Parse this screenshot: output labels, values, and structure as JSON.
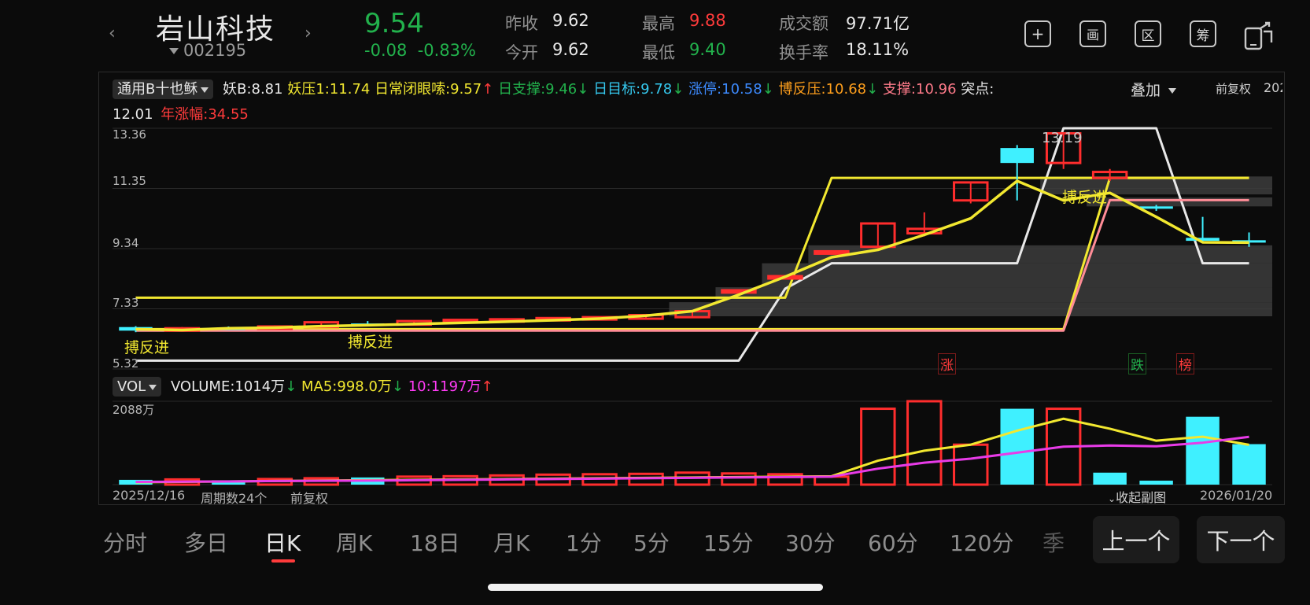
{
  "header": {
    "name": "岩山科技",
    "code": "002195",
    "price": "9.54",
    "change": "-0.08",
    "change_pct": "-0.83%",
    "prev_close_label": "昨收",
    "prev_close": "9.62",
    "open_label": "今开",
    "open": "9.62",
    "high_label": "最高",
    "high": "9.88",
    "low_label": "最低",
    "low": "9.40",
    "amount_label": "成交额",
    "amount": "97.71亿",
    "turnover_label": "换手率",
    "turnover": "18.11%",
    "icons": [
      "plus-icon",
      "picture-icon",
      "range-icon",
      "chip-icon",
      "phone-share-icon"
    ],
    "icon_glyphs": [
      "+",
      "画",
      "区",
      "筹",
      ""
    ]
  },
  "indicator": {
    "selector": "通用B十也稣",
    "items": [
      {
        "text": "妖B:8.81",
        "color": "#e8e8e8"
      },
      {
        "text": "妖压1:11.74",
        "color": "#f2e830"
      },
      {
        "text": "日常闭眼嗦:9.57",
        "color": "#f2e830",
        "arrow": "↑",
        "arrow_color": "#ff3b3b"
      },
      {
        "text": "日支撑:9.46",
        "color": "#22b14c",
        "arrow": "↓",
        "arrow_color": "#22b14c"
      },
      {
        "text": "日目标:9.78",
        "color": "#35c8ee",
        "arrow": "↓",
        "arrow_color": "#22b14c"
      },
      {
        "text": "涨停:10.58",
        "color": "#3d8bff",
        "arrow": "↓",
        "arrow_color": "#22b14c"
      },
      {
        "text": "博反压:10.68",
        "color": "#ff9f1c",
        "arrow": "↓",
        "arrow_color": "#22b14c"
      },
      {
        "text": "支撑:10.96",
        "color": "#ff7b8a"
      },
      {
        "text": "突点:",
        "color": "#e8e8e8"
      }
    ],
    "line2_value": "12.01",
    "line2_label": "年涨幅:34.55",
    "overlay": "叠加",
    "adjust": "前复权",
    "cut_text": "202"
  },
  "price_axis": [
    "13.36",
    "11.35",
    "9.34",
    "7.33",
    "5.32"
  ],
  "chart_labels": {
    "peak": "13.19",
    "bofanjin1": "搏反进",
    "bofanjin2": "搏反进",
    "bofanjin3": "搏反进",
    "tag_zhang": "涨",
    "tag_die": "跌",
    "tag_bang": "榜"
  },
  "volume": {
    "selector": "VOL",
    "volume_text": "VOLUME:1014万",
    "ma5_text": "MA5:998.0万",
    "ma10_text": "10:1197万",
    "axis_max": "2088万"
  },
  "chart_data": {
    "type": "candlestick",
    "candles": [
      {
        "o": 6.72,
        "c": 6.6,
        "h": 6.75,
        "l": 6.55
      },
      {
        "o": 6.62,
        "c": 6.68,
        "h": 6.72,
        "l": 6.6
      },
      {
        "o": 6.7,
        "c": 6.66,
        "h": 6.74,
        "l": 6.62
      },
      {
        "o": 6.68,
        "c": 6.74,
        "h": 6.78,
        "l": 6.65
      },
      {
        "o": 6.72,
        "c": 6.88,
        "h": 6.9,
        "l": 6.7
      },
      {
        "o": 6.84,
        "c": 6.8,
        "h": 6.92,
        "l": 6.76
      },
      {
        "o": 6.8,
        "c": 6.92,
        "h": 6.95,
        "l": 6.78
      },
      {
        "o": 6.88,
        "c": 6.96,
        "h": 6.98,
        "l": 6.84
      },
      {
        "o": 6.92,
        "c": 6.98,
        "h": 7.0,
        "l": 6.9
      },
      {
        "o": 6.95,
        "c": 7.02,
        "h": 7.05,
        "l": 6.92
      },
      {
        "o": 7.0,
        "c": 7.05,
        "h": 7.08,
        "l": 6.96
      },
      {
        "o": 7.0,
        "c": 7.12,
        "h": 7.16,
        "l": 6.98
      },
      {
        "o": 7.05,
        "c": 7.25,
        "h": 7.28,
        "l": 7.02
      },
      {
        "o": 7.95,
        "c": 7.95,
        "h": 7.98,
        "l": 7.92
      },
      {
        "o": 8.42,
        "c": 8.42,
        "h": 8.45,
        "l": 8.38
      },
      {
        "o": 9.25,
        "c": 9.25,
        "h": 9.28,
        "l": 9.22
      },
      {
        "o": 9.4,
        "c": 10.18,
        "h": 10.2,
        "l": 9.35
      },
      {
        "o": 9.85,
        "c": 10.0,
        "h": 10.55,
        "l": 9.75
      },
      {
        "o": 10.95,
        "c": 11.55,
        "h": 11.55,
        "l": 10.85
      },
      {
        "o": 12.7,
        "c": 12.2,
        "h": 12.8,
        "l": 10.95
      },
      {
        "o": 12.2,
        "c": 13.19,
        "h": 13.19,
        "l": 12.0
      },
      {
        "o": 11.7,
        "c": 11.9,
        "h": 12.0,
        "l": 11.6
      },
      {
        "o": 10.75,
        "c": 10.7,
        "h": 10.8,
        "l": 10.6
      },
      {
        "o": 9.7,
        "c": 9.6,
        "h": 10.4,
        "l": 9.55
      },
      {
        "o": 9.62,
        "c": 9.54,
        "h": 9.88,
        "l": 9.4
      }
    ],
    "yellow_line": [
      6.65,
      6.62,
      6.68,
      6.7,
      6.75,
      6.78,
      6.82,
      6.86,
      6.9,
      6.95,
      7.0,
      7.1,
      7.25,
      7.8,
      8.4,
      9.05,
      9.3,
      9.8,
      10.35,
      11.6,
      10.95,
      11.2,
      10.4,
      9.55,
      9.54
    ],
    "white_channel_upper": [
      5.6,
      5.6,
      5.6,
      5.6,
      5.6,
      5.6,
      5.6,
      5.6,
      5.6,
      5.6,
      5.6,
      5.6,
      5.6,
      5.6,
      8.4,
      8.4,
      8.4,
      8.4,
      8.4,
      13.36,
      13.36,
      13.36,
      8.4,
      8.4,
      8.4
    ],
    "volume_values": [
      120,
      130,
      110,
      140,
      160,
      180,
      200,
      210,
      230,
      250,
      260,
      270,
      300,
      280,
      260,
      200,
      1900,
      2088,
      1000,
      1900,
      1900,
      300,
      100,
      1700,
      1014
    ],
    "ma5": [
      60,
      70,
      80,
      90,
      100,
      110,
      120,
      130,
      140,
      150,
      160,
      170,
      180,
      190,
      200,
      210,
      600,
      850,
      1000,
      1350,
      1650,
      1400,
      1100,
      1200,
      998
    ],
    "ma10": [
      70,
      75,
      80,
      90,
      95,
      100,
      110,
      120,
      130,
      140,
      150,
      160,
      170,
      180,
      190,
      200,
      400,
      550,
      650,
      800,
      950,
      980,
      960,
      1050,
      1197
    ],
    "start_date": "2025/12/16",
    "end_date": "2026/01/20",
    "period_count": "周期数24个",
    "adjust": "前复权"
  },
  "footer": {
    "collapse": "收起副图"
  },
  "tabs": [
    "分时",
    "多日",
    "日K",
    "周K",
    "18日",
    "月K",
    "1分",
    "5分",
    "15分",
    "30分",
    "60分",
    "120分",
    "季"
  ],
  "active_tab": "日K",
  "prev_button": "上一个",
  "next_button": "下一个"
}
